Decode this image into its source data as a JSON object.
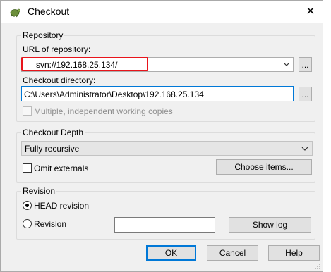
{
  "window": {
    "title": "Checkout",
    "close_glyph": "✕"
  },
  "repository": {
    "group_label": "Repository",
    "url_label": "URL of repository:",
    "url_value": "svn://192.168.25.134/",
    "browse_label": "...",
    "dir_label": "Checkout directory:",
    "dir_value": "C:\\Users\\Administrator\\Desktop\\192.168.25.134",
    "dir_browse_label": "...",
    "multi_wc_label": "Multiple, independent working copies"
  },
  "depth": {
    "group_label": "Checkout Depth",
    "selected": "Fully recursive",
    "omit_externals_label": "Omit externals",
    "choose_items_label": "Choose items..."
  },
  "revision": {
    "group_label": "Revision",
    "head_label": "HEAD revision",
    "revision_label": "Revision",
    "revision_value": "",
    "show_log_label": "Show log"
  },
  "footer": {
    "ok_label": "OK",
    "cancel_label": "Cancel",
    "help_label": "Help"
  },
  "colors": {
    "highlight": "#e8141b",
    "focus": "#0078d7",
    "dialog_bg": "#f0f0f0"
  }
}
